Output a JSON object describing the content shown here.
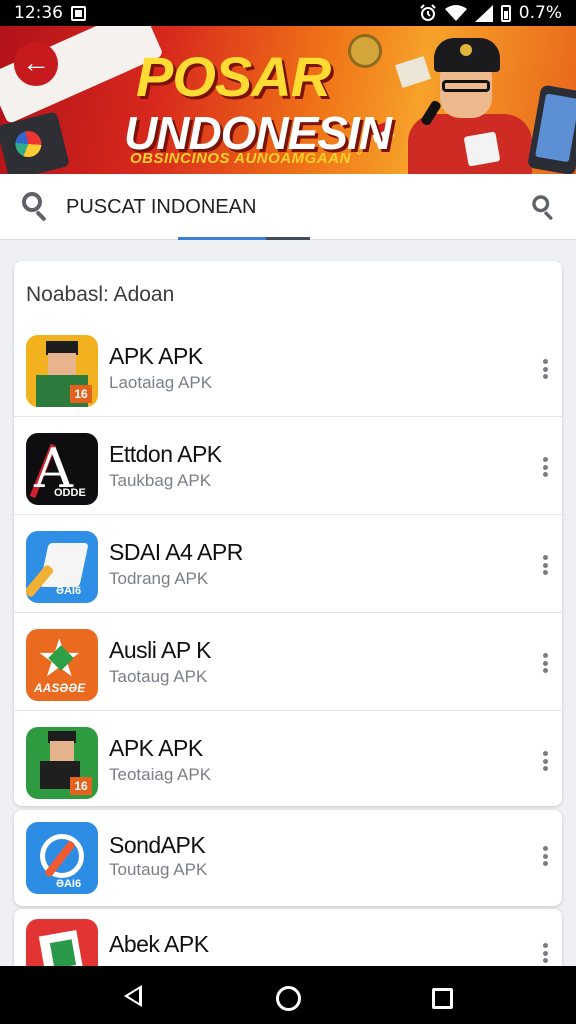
{
  "status_bar": {
    "time": "12:36",
    "battery": "0.7%",
    "icons": [
      "gallery-icon",
      "alarm-icon",
      "wifi-icon",
      "signal-icon",
      "battery-icon"
    ]
  },
  "banner": {
    "title_line1": "POSAR",
    "title_line2": "UNDONESIN",
    "subtitle": "OBSINCINOS AUNOAMGAAN ˇ",
    "back_icon": "arrow-left-icon"
  },
  "search": {
    "query": "PUSCAT INDONEAN",
    "icon": "search-icon"
  },
  "section": {
    "title": "Noabasl: Adoan"
  },
  "apps": [
    {
      "name": "APK APK",
      "subtitle": "Laotaiag APK",
      "icon": "blocky-character-icon"
    },
    {
      "name": "Ettdon APK",
      "subtitle": "Taukbag APK",
      "icon": "letter-a-icon"
    },
    {
      "name": "SDAI A4 APR",
      "subtitle": "Todrang APK",
      "icon": "paint-brush-icon"
    },
    {
      "name": "Ausli AP K",
      "subtitle": "Taotaug APK",
      "icon": "star-icon"
    },
    {
      "name": "APK APK",
      "subtitle": "Teotaiag APK",
      "icon": "blocky-character-icon"
    },
    {
      "name": "SondAPK",
      "subtitle": "Toutaug APK",
      "icon": "search-brush-icon"
    },
    {
      "name": "Abek APK",
      "subtitle": "",
      "icon": "box-icon"
    }
  ],
  "nav": {
    "back": "back-triangle-icon",
    "home": "home-circle-icon",
    "recent": "recents-square-icon"
  },
  "colors": {
    "accent": "#3b80d6",
    "banner_red": "#b2121a",
    "banner_orange": "#f07317",
    "title_yellow": "#ffdc33"
  }
}
